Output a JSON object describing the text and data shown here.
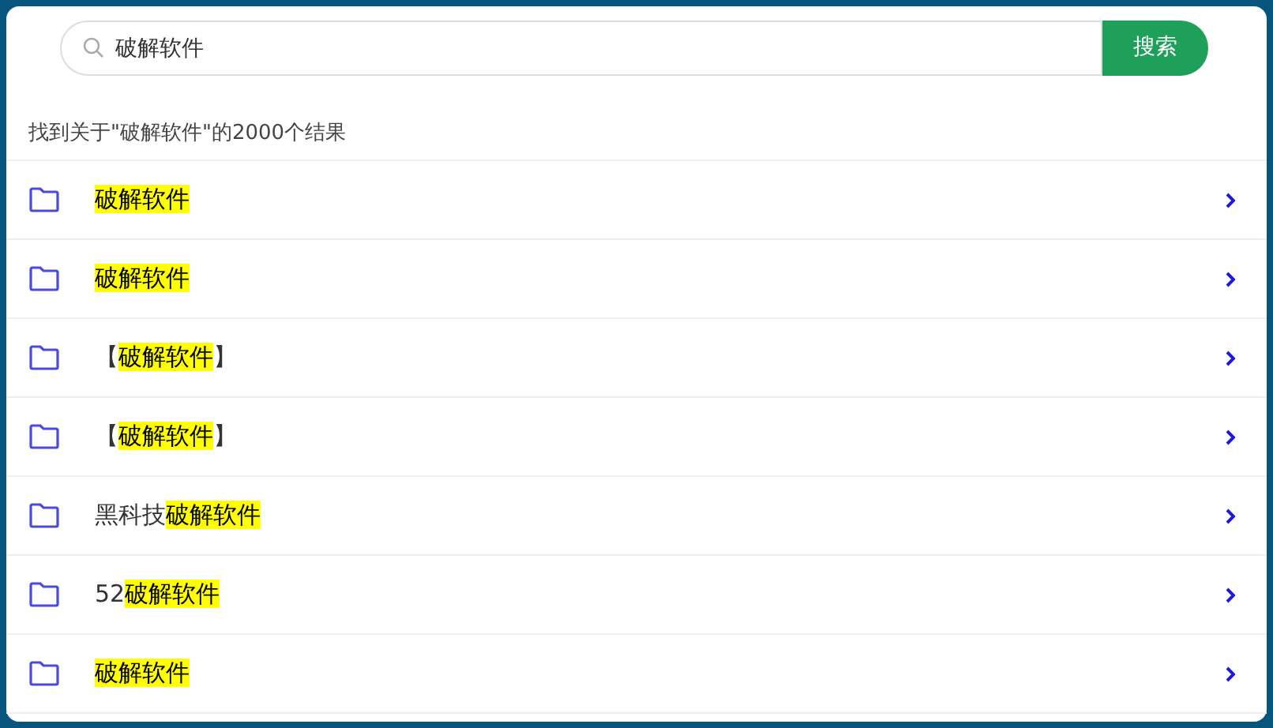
{
  "search": {
    "value": "破解软件",
    "button": "搜索"
  },
  "summary": "找到关于\"破解软件\"的2000个结果",
  "results": [
    {
      "parts": [
        {
          "text": "破解软件",
          "highlighted": true
        }
      ]
    },
    {
      "parts": [
        {
          "text": "破解软件",
          "highlighted": true
        }
      ]
    },
    {
      "parts": [
        {
          "text": "【",
          "highlighted": false
        },
        {
          "text": "破解软件",
          "highlighted": true
        },
        {
          "text": "】",
          "highlighted": false
        }
      ]
    },
    {
      "parts": [
        {
          "text": "【",
          "highlighted": false
        },
        {
          "text": "破解软件",
          "highlighted": true
        },
        {
          "text": "】",
          "highlighted": false
        }
      ]
    },
    {
      "parts": [
        {
          "text": "黑科技",
          "highlighted": false
        },
        {
          "text": "破解软件",
          "highlighted": true
        }
      ]
    },
    {
      "parts": [
        {
          "text": "52",
          "highlighted": false
        },
        {
          "text": "破解软件",
          "highlighted": true
        }
      ]
    },
    {
      "parts": [
        {
          "text": "破解软件",
          "highlighted": true
        }
      ]
    }
  ]
}
